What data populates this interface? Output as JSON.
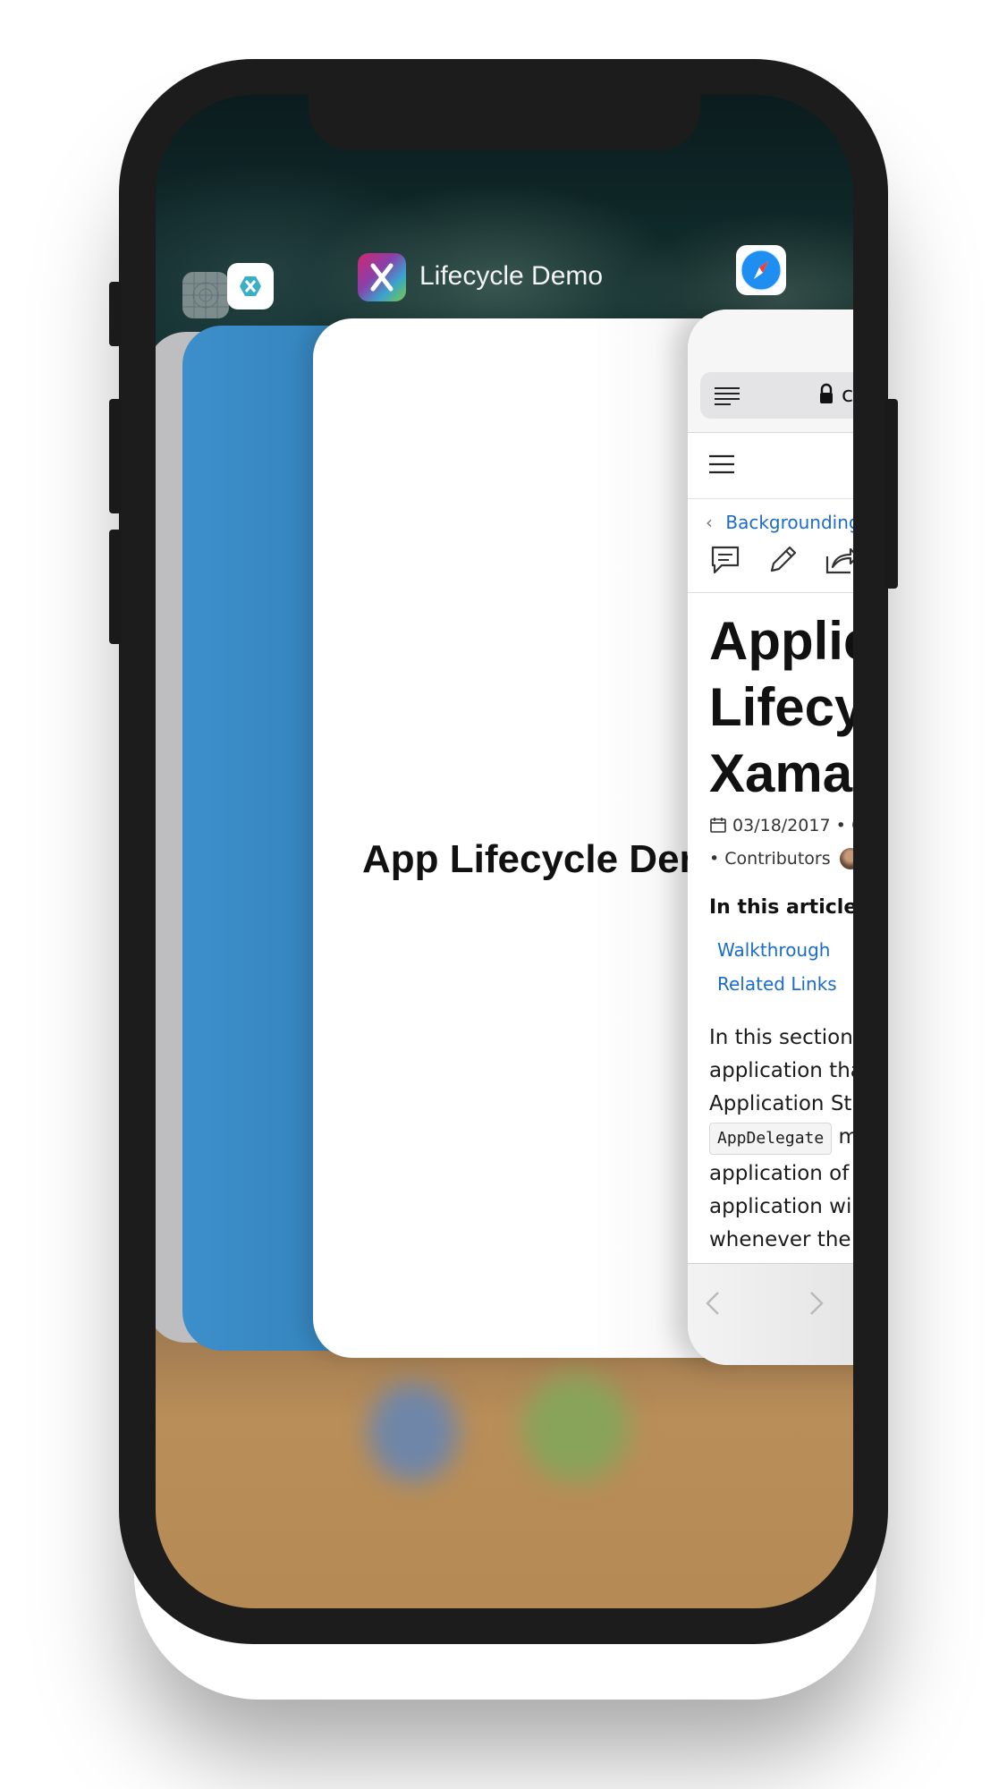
{
  "switcher": {
    "active_app_title": "Lifecycle Demo",
    "app_icons": [
      "placeholder-app-icon",
      "xamarin-icon",
      "lifecycle-demo-icon",
      "safari-icon"
    ]
  },
  "app_card": {
    "title": "App Lifecycle Der"
  },
  "safari_card": {
    "url_fragment": "c",
    "breadcrumb": "Backgrounding",
    "article_title_lines": [
      "Applic",
      "Lifecyc",
      "Xamar"
    ],
    "date": "03/18/2017",
    "meta_sep": "•",
    "contributors_label": "• Contributors",
    "in_this_article": "In this article",
    "toc": [
      "Walkthrough",
      "Related Links"
    ],
    "paragraph_lines": [
      "In this section, w",
      "application that",
      "Application Stat",
      "",
      "application of w",
      "application will p",
      "whenever the ap"
    ],
    "code_text": "AppDelegate",
    "code_trailing": "m"
  },
  "colors": {
    "link_blue": "#1a6cc9",
    "app_blue": "#2e7cb3",
    "safari_blue": "#1e8ef0",
    "xamarin_teal": "#3ab0c6"
  }
}
